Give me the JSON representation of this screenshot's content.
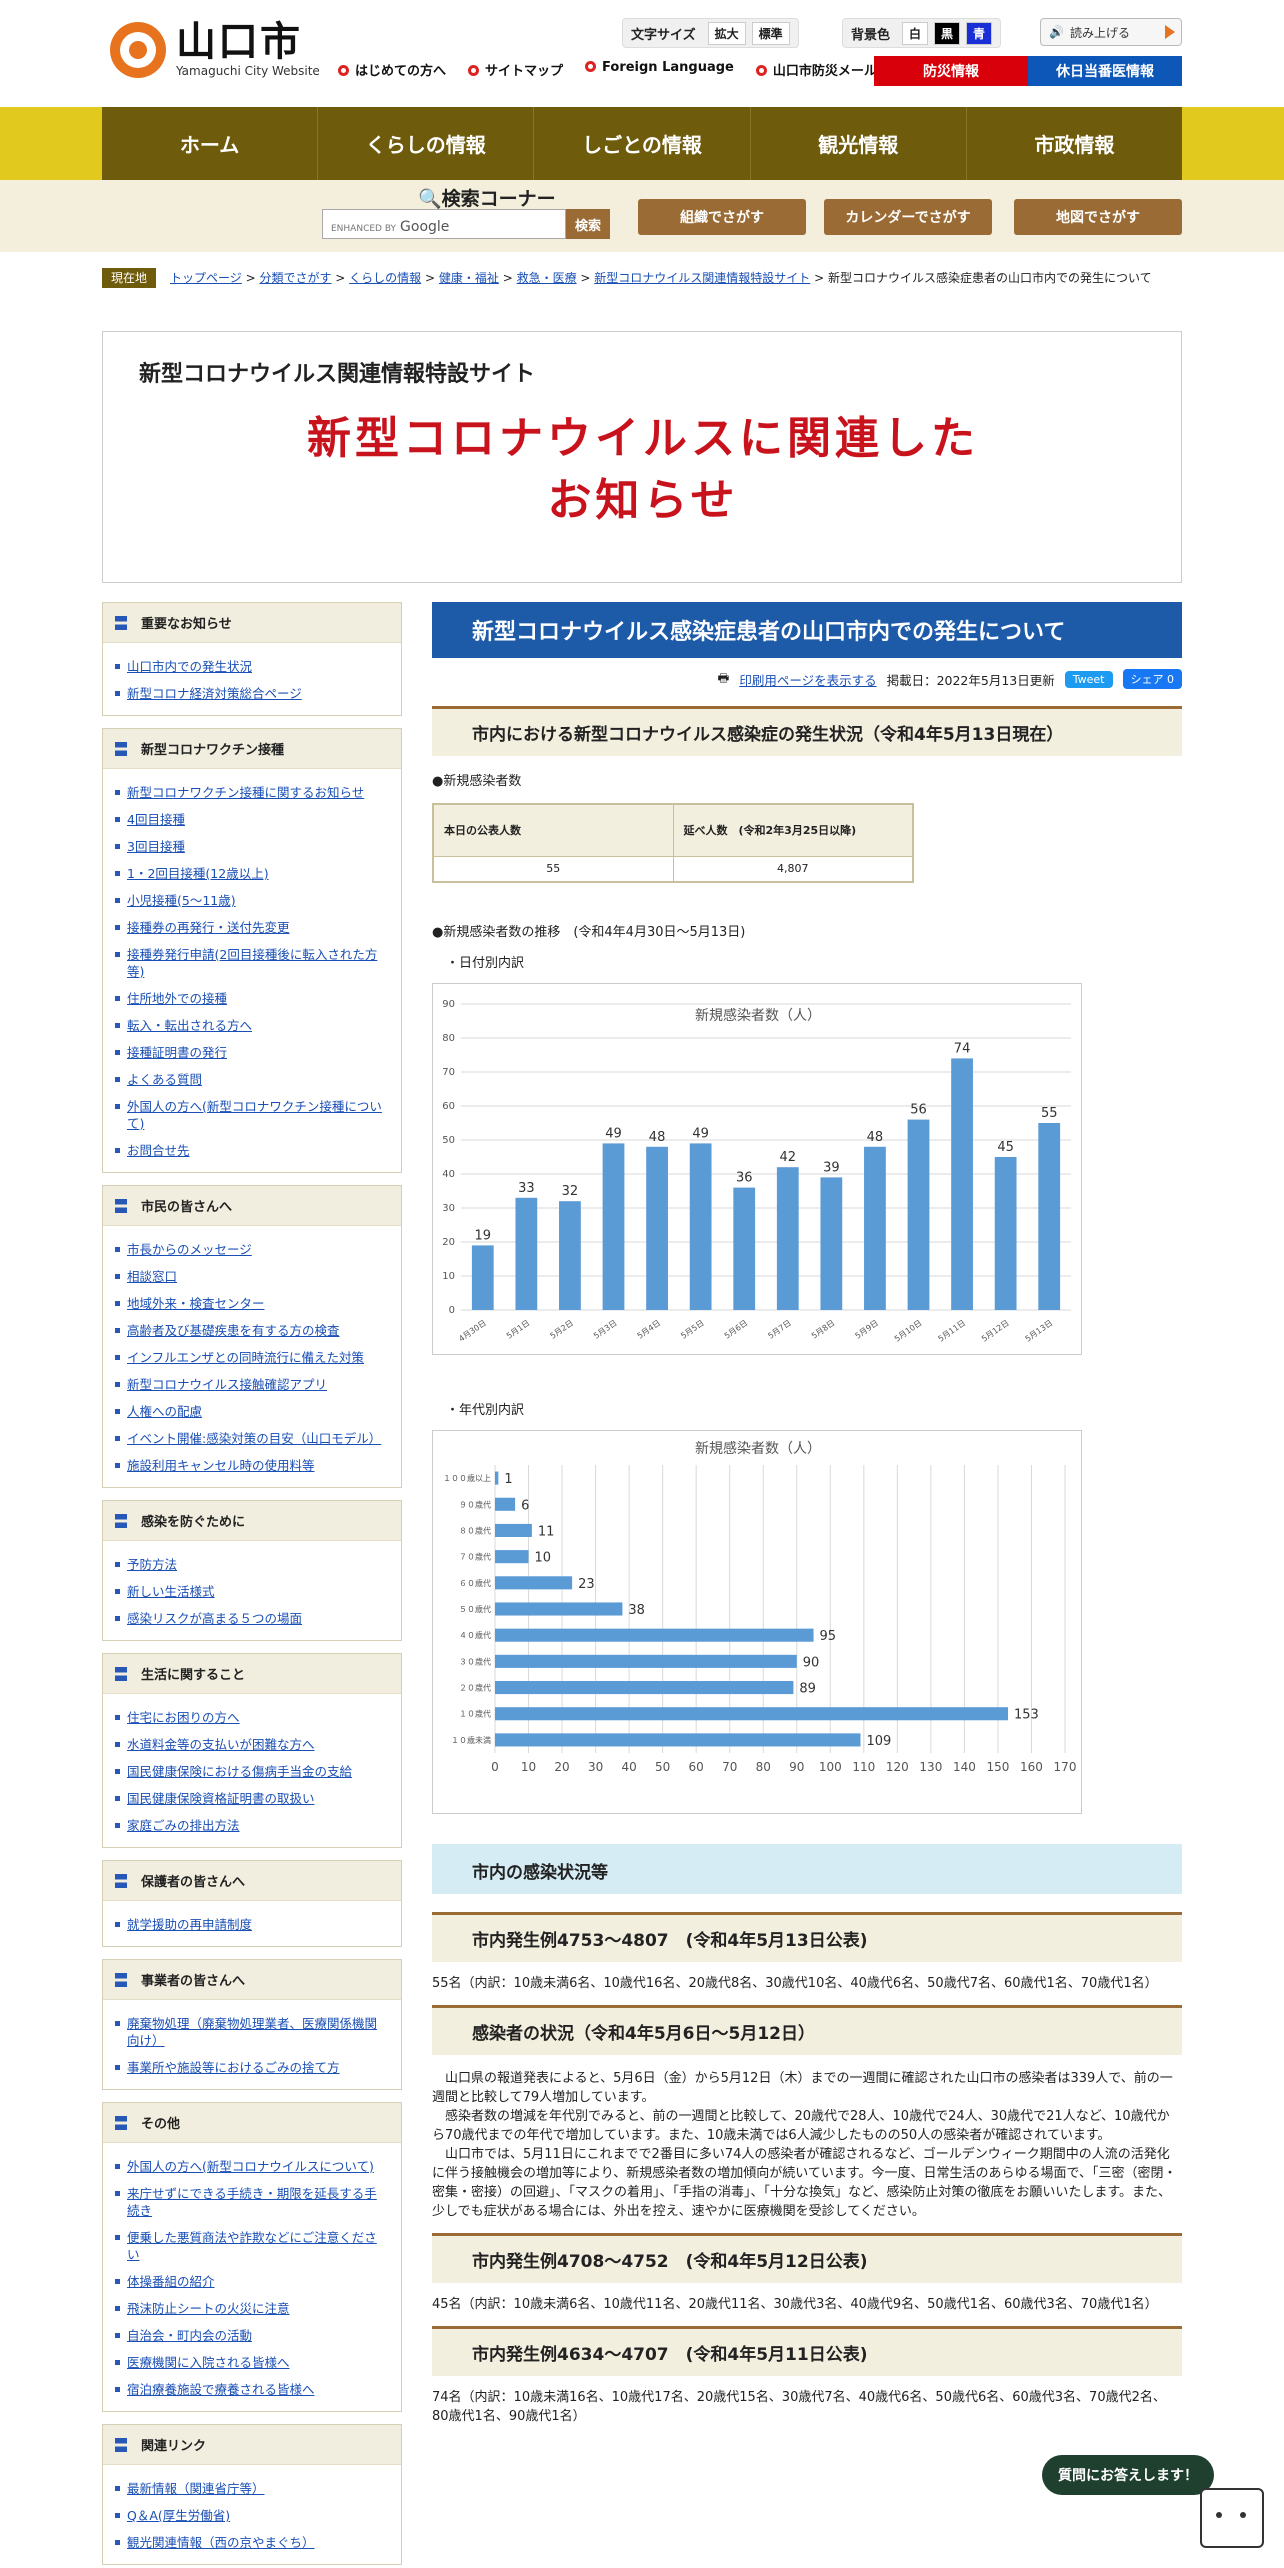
{
  "header": {
    "logo_title": "山口市",
    "logo_sub": "Yamaguchi City Website",
    "font_size_label": "文字サイズ",
    "font_large": "拡大",
    "font_std": "標準",
    "bg_label": "背景色",
    "bg_white": "白",
    "bg_black": "黒",
    "bg_blue": "青",
    "read_label": "読み上げる",
    "links": [
      "はじめての方へ",
      "サイトマップ",
      "Foreign Language",
      "山口市防災メール"
    ],
    "bousai": "防災情報",
    "kyujitsu": "休日当番医情報"
  },
  "nav": [
    "ホーム",
    "くらしの情報",
    "しごとの情報",
    "観光情報",
    "市政情報"
  ],
  "search": {
    "title": "検索コーナー",
    "enhanced": "ENHANCED BY",
    "google": "Google",
    "button": "検索",
    "buttons": [
      "組織でさがす",
      "カレンダーでさがす",
      "地図でさがす"
    ]
  },
  "breadcrumb": {
    "tag": "現在地",
    "links": [
      "トップページ",
      "分類でさがす",
      "くらしの情報",
      "健康・福祉",
      "救急・医療",
      "新型コロナウイルス関連情報特設サイト"
    ],
    "current": "新型コロナウイルス感染症患者の山口市内での発生について"
  },
  "title_panel": {
    "sub": "新型コロナウイルス関連情報特設サイト",
    "main1": "新型コロナウイルスに関連した",
    "main2": "お知らせ"
  },
  "sidebar": [
    {
      "title": "重要なお知らせ",
      "items": [
        "山口市内での発生状況",
        "新型コロナ経済対策総合ページ"
      ]
    },
    {
      "title": "新型コロナワクチン接種",
      "items": [
        "新型コロナワクチン接種に関するお知らせ",
        "4回目接種",
        "3回目接種",
        "1・2回目接種(12歳以上)",
        "小児接種(5～11歳)",
        "接種券の再発行・送付先変更",
        "接種券発行申請(2回目接種後に転入された方等)",
        "住所地外での接種",
        "転入・転出される方へ",
        "接種証明書の発行",
        "よくある質問",
        "外国人の方へ(新型コロナワクチン接種について)",
        "お問合せ先"
      ]
    },
    {
      "title": "市民の皆さんへ",
      "items": [
        "市長からのメッセージ",
        "相談窓口",
        "地域外来・検査センター",
        "高齢者及び基礎疾患を有する方の検査",
        "インフルエンザとの同時流行に備えた対策",
        "新型コロナウイルス接触確認アプリ",
        "人権への配慮",
        "イベント開催:感染対策の目安（山口モデル）",
        "施設利用キャンセル時の使用料等"
      ]
    },
    {
      "title": "感染を防ぐために",
      "items": [
        "予防方法",
        "新しい生活様式",
        "感染リスクが高まる５つの場面"
      ]
    },
    {
      "title": "生活に関すること",
      "items": [
        "住宅にお困りの方へ",
        "水道料金等の支払いが困難な方へ",
        "国民健康保険における傷病手当金の支給",
        "国民健康保険資格証明書の取扱い",
        "家庭ごみの排出方法"
      ]
    },
    {
      "title": "保護者の皆さんへ",
      "items": [
        "就学援助の再申請制度"
      ]
    },
    {
      "title": "事業者の皆さんへ",
      "items": [
        "廃棄物処理（廃棄物処理業者、医療関係機関向け）",
        "事業所や施設等におけるごみの捨て方"
      ]
    },
    {
      "title": "その他",
      "items": [
        "外国人の方へ(新型コロナウイルスについて)",
        "来庁せずにできる手続き・期限を延長する手続き",
        "便乗した悪質商法や詐欺などにご注意ください",
        "体操番組の紹介",
        "飛沫防止シートの火災に注意",
        "自治会・町内会の活動",
        "医療機関に入院される皆様へ",
        "宿泊療養施設で療養される皆様へ"
      ]
    },
    {
      "title": "関連リンク",
      "items": [
        "最新情報（関連省庁等）",
        "Q＆A(厚生労働省)",
        "観光関連情報（西の京やまぐち）"
      ]
    }
  ],
  "main": {
    "page_title": "新型コロナウイルス感染症患者の山口市内での発生について",
    "print": "印刷用ページを表示する",
    "date": "掲載日：2022年5月13日更新",
    "tweet": "Tweet",
    "share": "シェア 0",
    "sec1": "市内における新型コロナウイルス感染症の発生状況（令和4年5月13日現在）",
    "new_cases": "●新規感染者数",
    "table_h1": "本日の公表人数",
    "table_h2": "延べ人数　(令和2年3月25日以降)",
    "table_v1": "55",
    "table_v2": "4,807",
    "trend": "●新規感染者数の推移　(令和4年4月30日～5月13日)",
    "by_date": "・日付別内訳",
    "by_age": "・年代別内訳",
    "sec_blue": "市内の感染状況等",
    "sec2": "市内発生例4753～4807　(令和4年5月13日公表)",
    "p2": "55名（内訳：10歳未満6名、10歳代16名、20歳代8名、30歳代10名、40歳代6名、50歳代7名、60歳代1名、70歳代1名）",
    "sec3": "感染者の状況（令和4年5月6日～5月12日）",
    "p3a": "　山口県の報道発表によると、5月6日（金）から5月12日（木）までの一週間に確認された山口市の感染者は339人で、前の一週間と比較して79人増加しています。",
    "p3b": "　感染者数の増減を年代別でみると、前の一週間と比較して、20歳代で28人、10歳代で24人、30歳代で21人など、10歳代から70歳代までの年代で増加しています。また、10歳未満では6人減少したものの50人の感染者が確認されています。",
    "p3c": "　山口市では、5月11日にこれまでで2番目に多い74人の感染者が確認されるなど、ゴールデンウィーク期間中の人流の活発化に伴う接触機会の増加等により、新規感染者数の増加傾向が続いています。今一度、日常生活のあらゆる場面で、「三密（密閉・密集・密接）の回避」、「マスクの着用」、「手指の消毒」、「十分な換気」など、感染防止対策の徹底をお願いいたします。また、少しでも症状がある場合には、外出を控え、速やかに医療機関を受診してください。",
    "sec4": "市内発生例4708～4752　(令和4年5月12日公表)",
    "p4": "45名（内訳：10歳未満6名、10歳代11名、20歳代11名、30歳代3名、40歳代9名、50歳代1名、60歳代3名、70歳代1名）",
    "sec5": "市内発生例4634～4707　(令和4年5月11日公表)",
    "p5": "74名（内訳：10歳未満16名、10歳代17名、20歳代15名、30歳代7名、40歳代6名、50歳代6名、60歳代3名、70歳代2名、80歳代1名、90歳代1名）"
  },
  "chat": {
    "label": "質問にお答えします！"
  },
  "colors": {
    "accent_blue": "#1d5aa8",
    "bar": "#5b9bd5",
    "brown": "#9a6b35",
    "red_title": "#c8121c"
  },
  "chart_data": [
    {
      "type": "bar",
      "title": "新規感染者数（人）",
      "categories": [
        "4月30日",
        "5月1日",
        "5月2日",
        "5月3日",
        "5月4日",
        "5月5日",
        "5月6日",
        "5月7日",
        "5月8日",
        "5月9日",
        "5月10日",
        "5月11日",
        "5月12日",
        "5月13日"
      ],
      "values": [
        19,
        33,
        32,
        49,
        48,
        49,
        36,
        42,
        39,
        48,
        56,
        74,
        45,
        55
      ],
      "ylim": [
        0,
        90
      ],
      "yticks": [
        0,
        10,
        20,
        30,
        40,
        50,
        60,
        70,
        80,
        90
      ],
      "grid": true
    },
    {
      "type": "bar",
      "orientation": "horizontal",
      "title": "新規感染者数（人）",
      "categories": [
        "１００歳以上",
        "９０歳代",
        "８０歳代",
        "７０歳代",
        "６０歳代",
        "５０歳代",
        "４０歳代",
        "３０歳代",
        "２０歳代",
        "１０歳代",
        "１０歳未満"
      ],
      "values": [
        1,
        6,
        11,
        10,
        23,
        38,
        95,
        90,
        89,
        153,
        109
      ],
      "xlim": [
        0,
        170
      ],
      "xticks": [
        0,
        10,
        20,
        30,
        40,
        50,
        60,
        70,
        80,
        90,
        100,
        110,
        120,
        130,
        140,
        150,
        160,
        170
      ],
      "grid": true
    }
  ]
}
